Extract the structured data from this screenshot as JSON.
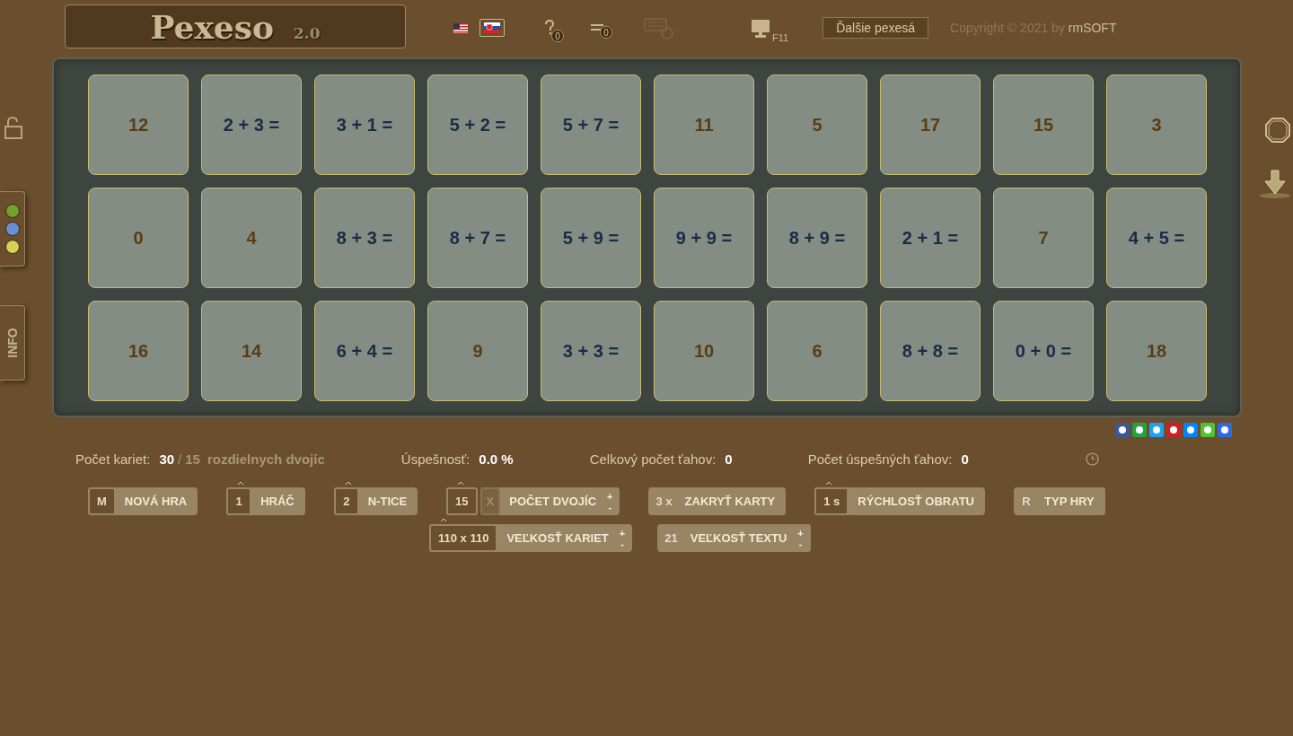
{
  "header": {
    "title": "Pexeso",
    "version": "2.0",
    "languages": [
      {
        "kind": "us",
        "selected": false
      },
      {
        "kind": "sk",
        "selected": true
      }
    ],
    "help_count": "0",
    "list_count": "0",
    "fullscreen_key": "F11",
    "more_button": "Ďalšie pexesá",
    "copyright": "Copyright © 2021 by",
    "brand": "rmSOFT"
  },
  "sidebar": {
    "theme_dots": [
      {
        "color": "#72a02a"
      },
      {
        "color": "#6a8fd8"
      },
      {
        "color": "#d6d154"
      }
    ],
    "info_tab": "INFO"
  },
  "cards": [
    {
      "text": "12",
      "kind": "number"
    },
    {
      "text": "2 + 3 =",
      "kind": "equation"
    },
    {
      "text": "3 + 1 =",
      "kind": "equation"
    },
    {
      "text": "5 + 2 =",
      "kind": "equation"
    },
    {
      "text": "5 + 7 =",
      "kind": "equation"
    },
    {
      "text": "11",
      "kind": "number"
    },
    {
      "text": "5",
      "kind": "number"
    },
    {
      "text": "17",
      "kind": "number"
    },
    {
      "text": "15",
      "kind": "number"
    },
    {
      "text": "3",
      "kind": "number"
    },
    {
      "text": "0",
      "kind": "number"
    },
    {
      "text": "4",
      "kind": "number"
    },
    {
      "text": "8 + 3 =",
      "kind": "equation"
    },
    {
      "text": "8 + 7 =",
      "kind": "equation"
    },
    {
      "text": "5 + 9 =",
      "kind": "equation"
    },
    {
      "text": "9 + 9 =",
      "kind": "equation"
    },
    {
      "text": "8 + 9 =",
      "kind": "equation"
    },
    {
      "text": "2 + 1 =",
      "kind": "equation"
    },
    {
      "text": "7",
      "kind": "number"
    },
    {
      "text": "4 + 5 =",
      "kind": "equation"
    },
    {
      "text": "16",
      "kind": "number"
    },
    {
      "text": "14",
      "kind": "number"
    },
    {
      "text": "6 + 4 =",
      "kind": "equation"
    },
    {
      "text": "9",
      "kind": "number"
    },
    {
      "text": "3 + 3 =",
      "kind": "equation"
    },
    {
      "text": "10",
      "kind": "number"
    },
    {
      "text": "6",
      "kind": "number"
    },
    {
      "text": "8 + 8 =",
      "kind": "equation"
    },
    {
      "text": "0 + 0 =",
      "kind": "equation"
    },
    {
      "text": "18",
      "kind": "number"
    }
  ],
  "stats": {
    "cards_label": "Počet kariet:",
    "cards_value": "30",
    "separator": "/",
    "pairs_value": "15",
    "pairs_label": "rozdielnych dvojíc",
    "success_label": "Úspešnosť:",
    "success_value": "0.0 %",
    "moves_label": "Celkový počet ťahov:",
    "moves_value": "0",
    "good_moves_label": "Počet úspešných ťahov:",
    "good_moves_value": "0"
  },
  "controls": [
    [
      {
        "keys": [
          {
            "text": "M",
            "dim": false
          }
        ],
        "label": "NOVÁ HRA",
        "boxed": true,
        "caret": false
      },
      {
        "keys": [
          {
            "text": "1",
            "dim": false
          }
        ],
        "label": "HRÁČ",
        "boxed": true,
        "caret": true
      },
      {
        "keys": [
          {
            "text": "2",
            "dim": false
          }
        ],
        "label": "N-TICE",
        "boxed": true,
        "caret": true
      },
      {
        "keys": [
          {
            "text": "15",
            "dim": false
          },
          {
            "text": "X",
            "dim": true
          }
        ],
        "label": "POČET DVOJÍC",
        "boxed": true,
        "caret": true,
        "adjust": [
          "+",
          "-"
        ]
      },
      {
        "keys": [
          {
            "text": "3 x",
            "dim": false
          }
        ],
        "label": "ZAKRYŤ KARTY",
        "boxed": false,
        "caret": false
      },
      {
        "keys": [
          {
            "text": "1 s",
            "dim": false
          }
        ],
        "label": "RÝCHLOSŤ OBRATU",
        "boxed": true,
        "caret": true
      },
      {
        "keys": [
          {
            "text": "R",
            "dim": false
          }
        ],
        "label": "TYP HRY",
        "boxed": false,
        "caret": false
      }
    ],
    [
      {
        "keys": [
          {
            "text": "110 x 110",
            "dim": false
          }
        ],
        "label": "VEĽKOSŤ KARIET",
        "boxed": true,
        "caret": true,
        "adjust": [
          "+",
          "-"
        ]
      },
      {
        "keys": [
          {
            "text": "21",
            "dim": false
          }
        ],
        "label": "VEĽKOSŤ TEXTU",
        "boxed": false,
        "caret": false,
        "adjust": [
          "+",
          "-"
        ]
      }
    ]
  ]
}
